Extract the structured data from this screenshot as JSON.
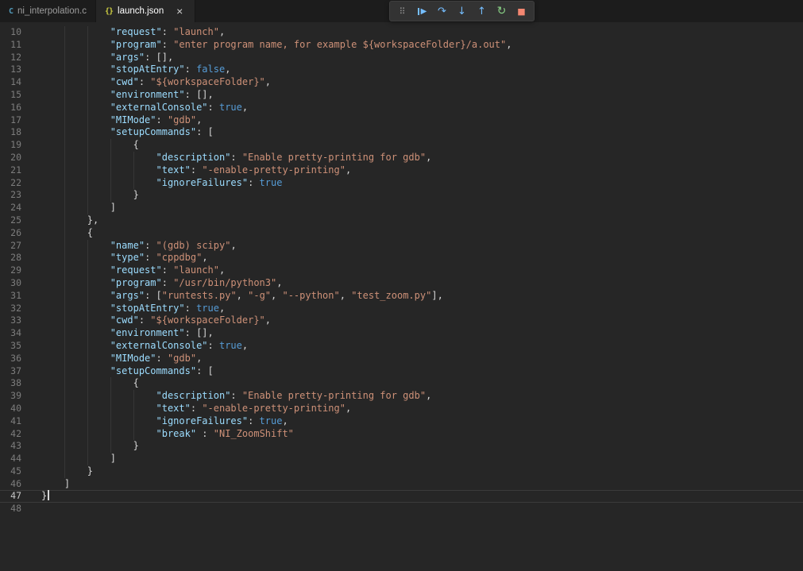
{
  "tabs": [
    {
      "label": "ni_interpolation.c",
      "icon_glyph": "C",
      "active": false
    },
    {
      "label": "launch.json",
      "icon_glyph": "{}",
      "active": true,
      "close_glyph": "×"
    }
  ],
  "debug_toolbar": {
    "buttons": [
      {
        "name": "drag-handle",
        "icon": "gripper-icon",
        "glyph": "⠿",
        "color": "#8a8a8a",
        "size": "11px"
      },
      {
        "name": "continue-button",
        "icon": "continue-icon",
        "glyph": "▶",
        "color": "#75beff",
        "size": "10px",
        "bar": true
      },
      {
        "name": "step-over-button",
        "icon": "step-over-icon",
        "glyph": "↷",
        "color": "#75beff",
        "size": "13px"
      },
      {
        "name": "step-into-button",
        "icon": "step-into-icon",
        "glyph": "↓",
        "color": "#75beff",
        "size": "13px"
      },
      {
        "name": "step-out-button",
        "icon": "step-out-icon",
        "glyph": "↑",
        "color": "#75beff",
        "size": "13px"
      },
      {
        "name": "restart-button",
        "icon": "restart-icon",
        "glyph": "↻",
        "color": "#89d185",
        "size": "14px"
      },
      {
        "name": "stop-button",
        "icon": "stop-icon",
        "glyph": "■",
        "color": "#f48771",
        "size": "11px"
      }
    ]
  },
  "colors": {
    "debug_blue": "#75beff",
    "restart_green": "#89d185",
    "stop_red": "#f48771",
    "json_key": "#9cdcfe",
    "json_string": "#ce9178",
    "json_keyword": "#569cd6"
  },
  "editor": {
    "active_line": 47,
    "lines": [
      {
        "n": 10,
        "t": [
          [
            "w",
            "            "
          ],
          [
            "k",
            "\"request\""
          ],
          [
            "p",
            ": "
          ],
          [
            "s",
            "\"launch\""
          ],
          [
            "p",
            ","
          ]
        ]
      },
      {
        "n": 11,
        "t": [
          [
            "w",
            "            "
          ],
          [
            "k",
            "\"program\""
          ],
          [
            "p",
            ": "
          ],
          [
            "s",
            "\"enter program name, for example ${workspaceFolder}/a.out\""
          ],
          [
            "p",
            ","
          ]
        ]
      },
      {
        "n": 12,
        "t": [
          [
            "w",
            "            "
          ],
          [
            "k",
            "\"args\""
          ],
          [
            "p",
            ": [],"
          ]
        ]
      },
      {
        "n": 13,
        "t": [
          [
            "w",
            "            "
          ],
          [
            "k",
            "\"stopAtEntry\""
          ],
          [
            "p",
            ": "
          ],
          [
            "b",
            "false"
          ],
          [
            "p",
            ","
          ]
        ]
      },
      {
        "n": 14,
        "t": [
          [
            "w",
            "            "
          ],
          [
            "k",
            "\"cwd\""
          ],
          [
            "p",
            ": "
          ],
          [
            "s",
            "\"${workspaceFolder}\""
          ],
          [
            "p",
            ","
          ]
        ]
      },
      {
        "n": 15,
        "t": [
          [
            "w",
            "            "
          ],
          [
            "k",
            "\"environment\""
          ],
          [
            "p",
            ": [],"
          ]
        ]
      },
      {
        "n": 16,
        "t": [
          [
            "w",
            "            "
          ],
          [
            "k",
            "\"externalConsole\""
          ],
          [
            "p",
            ": "
          ],
          [
            "b",
            "true"
          ],
          [
            "p",
            ","
          ]
        ]
      },
      {
        "n": 17,
        "t": [
          [
            "w",
            "            "
          ],
          [
            "k",
            "\"MIMode\""
          ],
          [
            "p",
            ": "
          ],
          [
            "s",
            "\"gdb\""
          ],
          [
            "p",
            ","
          ]
        ]
      },
      {
        "n": 18,
        "t": [
          [
            "w",
            "            "
          ],
          [
            "k",
            "\"setupCommands\""
          ],
          [
            "p",
            ": ["
          ]
        ]
      },
      {
        "n": 19,
        "t": [
          [
            "w",
            "                "
          ],
          [
            "p",
            "{"
          ]
        ]
      },
      {
        "n": 20,
        "t": [
          [
            "w",
            "                    "
          ],
          [
            "k",
            "\"description\""
          ],
          [
            "p",
            ": "
          ],
          [
            "s",
            "\"Enable pretty-printing for gdb\""
          ],
          [
            "p",
            ","
          ]
        ]
      },
      {
        "n": 21,
        "t": [
          [
            "w",
            "                    "
          ],
          [
            "k",
            "\"text\""
          ],
          [
            "p",
            ": "
          ],
          [
            "s",
            "\"-enable-pretty-printing\""
          ],
          [
            "p",
            ","
          ]
        ]
      },
      {
        "n": 22,
        "t": [
          [
            "w",
            "                    "
          ],
          [
            "k",
            "\"ignoreFailures\""
          ],
          [
            "p",
            ": "
          ],
          [
            "b",
            "true"
          ]
        ]
      },
      {
        "n": 23,
        "t": [
          [
            "w",
            "                "
          ],
          [
            "p",
            "}"
          ]
        ]
      },
      {
        "n": 24,
        "t": [
          [
            "w",
            "            "
          ],
          [
            "p",
            "]"
          ]
        ]
      },
      {
        "n": 25,
        "t": [
          [
            "w",
            "        "
          ],
          [
            "p",
            "},"
          ]
        ]
      },
      {
        "n": 26,
        "t": [
          [
            "w",
            "        "
          ],
          [
            "p",
            "{"
          ]
        ]
      },
      {
        "n": 27,
        "t": [
          [
            "w",
            "            "
          ],
          [
            "k",
            "\"name\""
          ],
          [
            "p",
            ": "
          ],
          [
            "s",
            "\"(gdb) scipy\""
          ],
          [
            "p",
            ","
          ]
        ]
      },
      {
        "n": 28,
        "t": [
          [
            "w",
            "            "
          ],
          [
            "k",
            "\"type\""
          ],
          [
            "p",
            ": "
          ],
          [
            "s",
            "\"cppdbg\""
          ],
          [
            "p",
            ","
          ]
        ]
      },
      {
        "n": 29,
        "t": [
          [
            "w",
            "            "
          ],
          [
            "k",
            "\"request\""
          ],
          [
            "p",
            ": "
          ],
          [
            "s",
            "\"launch\""
          ],
          [
            "p",
            ","
          ]
        ]
      },
      {
        "n": 30,
        "t": [
          [
            "w",
            "            "
          ],
          [
            "k",
            "\"program\""
          ],
          [
            "p",
            ": "
          ],
          [
            "s",
            "\"/usr/bin/python3\""
          ],
          [
            "p",
            ","
          ]
        ]
      },
      {
        "n": 31,
        "t": [
          [
            "w",
            "            "
          ],
          [
            "k",
            "\"args\""
          ],
          [
            "p",
            ": ["
          ],
          [
            "s",
            "\"runtests.py\""
          ],
          [
            "p",
            ", "
          ],
          [
            "s",
            "\"-g\""
          ],
          [
            "p",
            ", "
          ],
          [
            "s",
            "\"--python\""
          ],
          [
            "p",
            ", "
          ],
          [
            "s",
            "\"test_zoom.py\""
          ],
          [
            "p",
            "],"
          ]
        ]
      },
      {
        "n": 32,
        "t": [
          [
            "w",
            "            "
          ],
          [
            "k",
            "\"stopAtEntry\""
          ],
          [
            "p",
            ": "
          ],
          [
            "b",
            "true"
          ],
          [
            "p",
            ","
          ]
        ]
      },
      {
        "n": 33,
        "t": [
          [
            "w",
            "            "
          ],
          [
            "k",
            "\"cwd\""
          ],
          [
            "p",
            ": "
          ],
          [
            "s",
            "\"${workspaceFolder}\""
          ],
          [
            "p",
            ","
          ]
        ]
      },
      {
        "n": 34,
        "t": [
          [
            "w",
            "            "
          ],
          [
            "k",
            "\"environment\""
          ],
          [
            "p",
            ": [],"
          ]
        ]
      },
      {
        "n": 35,
        "t": [
          [
            "w",
            "            "
          ],
          [
            "k",
            "\"externalConsole\""
          ],
          [
            "p",
            ": "
          ],
          [
            "b",
            "true"
          ],
          [
            "p",
            ","
          ]
        ]
      },
      {
        "n": 36,
        "t": [
          [
            "w",
            "            "
          ],
          [
            "k",
            "\"MIMode\""
          ],
          [
            "p",
            ": "
          ],
          [
            "s",
            "\"gdb\""
          ],
          [
            "p",
            ","
          ]
        ]
      },
      {
        "n": 37,
        "t": [
          [
            "w",
            "            "
          ],
          [
            "k",
            "\"setupCommands\""
          ],
          [
            "p",
            ": ["
          ]
        ]
      },
      {
        "n": 38,
        "t": [
          [
            "w",
            "                "
          ],
          [
            "p",
            "{"
          ]
        ]
      },
      {
        "n": 39,
        "t": [
          [
            "w",
            "                    "
          ],
          [
            "k",
            "\"description\""
          ],
          [
            "p",
            ": "
          ],
          [
            "s",
            "\"Enable pretty-printing for gdb\""
          ],
          [
            "p",
            ","
          ]
        ]
      },
      {
        "n": 40,
        "t": [
          [
            "w",
            "                    "
          ],
          [
            "k",
            "\"text\""
          ],
          [
            "p",
            ": "
          ],
          [
            "s",
            "\"-enable-pretty-printing\""
          ],
          [
            "p",
            ","
          ]
        ]
      },
      {
        "n": 41,
        "t": [
          [
            "w",
            "                    "
          ],
          [
            "k",
            "\"ignoreFailures\""
          ],
          [
            "p",
            ": "
          ],
          [
            "b",
            "true"
          ],
          [
            "p",
            ","
          ]
        ]
      },
      {
        "n": 42,
        "t": [
          [
            "w",
            "                    "
          ],
          [
            "k",
            "\"break\""
          ],
          [
            "p",
            " : "
          ],
          [
            "s",
            "\"NI_ZoomShift\""
          ]
        ]
      },
      {
        "n": 43,
        "t": [
          [
            "w",
            "                "
          ],
          [
            "p",
            "}"
          ]
        ]
      },
      {
        "n": 44,
        "t": [
          [
            "w",
            "            "
          ],
          [
            "p",
            "]"
          ]
        ]
      },
      {
        "n": 45,
        "t": [
          [
            "w",
            "        "
          ],
          [
            "p",
            "}"
          ]
        ]
      },
      {
        "n": 46,
        "t": [
          [
            "w",
            "    "
          ],
          [
            "p",
            "]"
          ]
        ]
      },
      {
        "n": 47,
        "t": [
          [
            "p",
            "}"
          ]
        ],
        "cursor": true
      },
      {
        "n": 48,
        "t": []
      }
    ]
  }
}
